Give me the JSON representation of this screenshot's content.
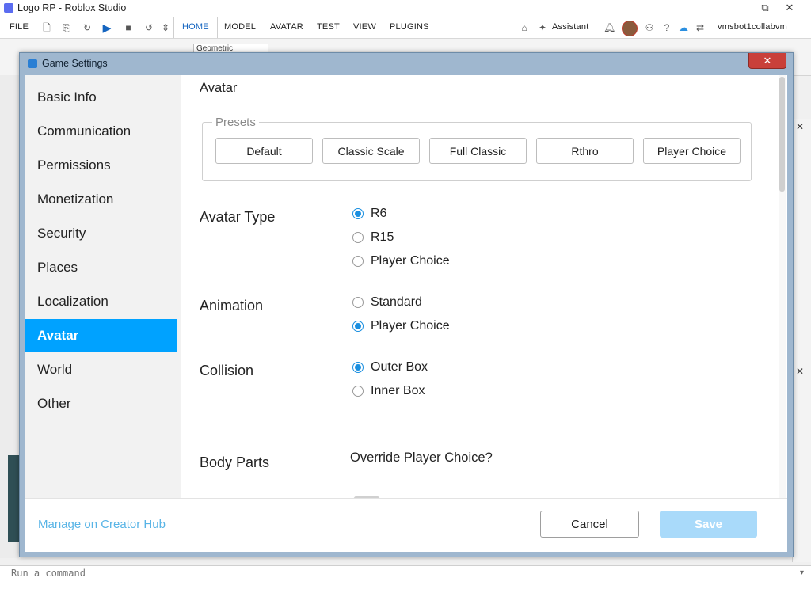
{
  "window": {
    "title": "Logo RP - Roblox Studio",
    "minimize": "—",
    "maximize": "⧉",
    "close": "✕"
  },
  "menubar": {
    "items": [
      "FILE",
      "HOME",
      "MODEL",
      "AVATAR",
      "TEST",
      "VIEW",
      "PLUGINS"
    ],
    "assistant": "Assistant",
    "username": "vmsbot1collabvm"
  },
  "toolbar": {
    "geometric": "Geometric"
  },
  "dialog": {
    "title": "Game Settings",
    "close": "✕",
    "nav": [
      "Basic Info",
      "Communication",
      "Permissions",
      "Monetization",
      "Security",
      "Places",
      "Localization",
      "Avatar",
      "World",
      "Other"
    ],
    "selected_nav": "Avatar",
    "section_title": "Avatar",
    "presets_label": "Presets",
    "presets": [
      "Default",
      "Classic Scale",
      "Full Classic",
      "Rthro",
      "Player Choice"
    ],
    "avatar_type": {
      "label": "Avatar Type",
      "options": [
        "R6",
        "R15",
        "Player Choice"
      ],
      "selected": "R6"
    },
    "animation": {
      "label": "Animation",
      "options": [
        "Standard",
        "Player Choice"
      ],
      "selected": "Player Choice"
    },
    "collision": {
      "label": "Collision",
      "options": [
        "Outer Box",
        "Inner Box"
      ],
      "selected": "Outer Box"
    },
    "body_parts": {
      "label": "Body Parts",
      "override_label": "Override Player Choice?"
    },
    "footer": {
      "link": "Manage on Creator Hub",
      "cancel": "Cancel",
      "save": "Save"
    }
  },
  "command_bar": {
    "placeholder": "Run a command",
    "caret": "▾"
  },
  "colors": {
    "accent": "#00a2ff",
    "radio": "#1a8fe0",
    "link": "#58b4e6",
    "save_disabled": "#a9dafa"
  }
}
